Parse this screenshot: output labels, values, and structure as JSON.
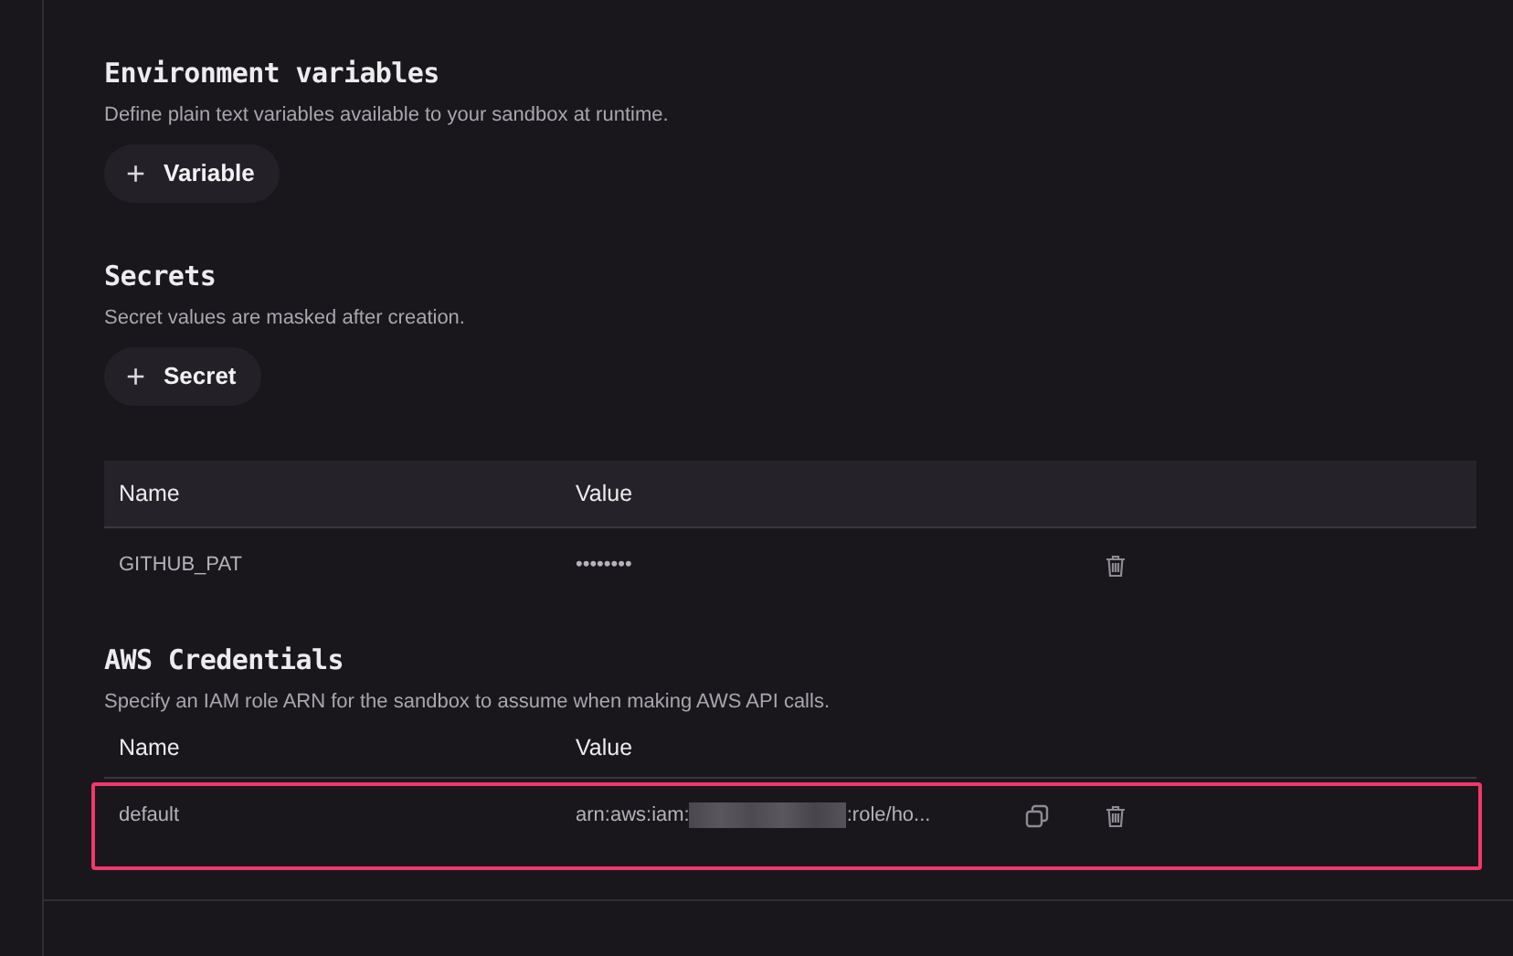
{
  "sections": [
    {
      "title": "Environment variables",
      "description": "Define plain text variables available to your sandbox at runtime.",
      "button": {
        "icon": "+",
        "label": "Variable"
      }
    },
    {
      "title": "Secrets",
      "description": "Secret values are masked after creation.",
      "button": {
        "icon": "+",
        "label": "Secret"
      },
      "table": {
        "columns": [
          "Name",
          "Value"
        ],
        "header_filled": true,
        "rows": [
          {
            "name": "GITHUB_PAT",
            "value_prefix": "••••••••",
            "redacted": false,
            "copyable": false,
            "highlighted": false
          }
        ]
      }
    },
    {
      "title": "AWS Credentials",
      "description": "Specify an IAM role ARN for the sandbox to assume when making AWS API calls.",
      "table": {
        "columns": [
          "Name",
          "Value"
        ],
        "header_filled": false,
        "rows": [
          {
            "name": "default",
            "value_prefix": "arn:aws:iam:",
            "redacted": true,
            "value_suffix": ":role/ho...",
            "copyable": true,
            "highlighted": true
          }
        ]
      }
    }
  ]
}
